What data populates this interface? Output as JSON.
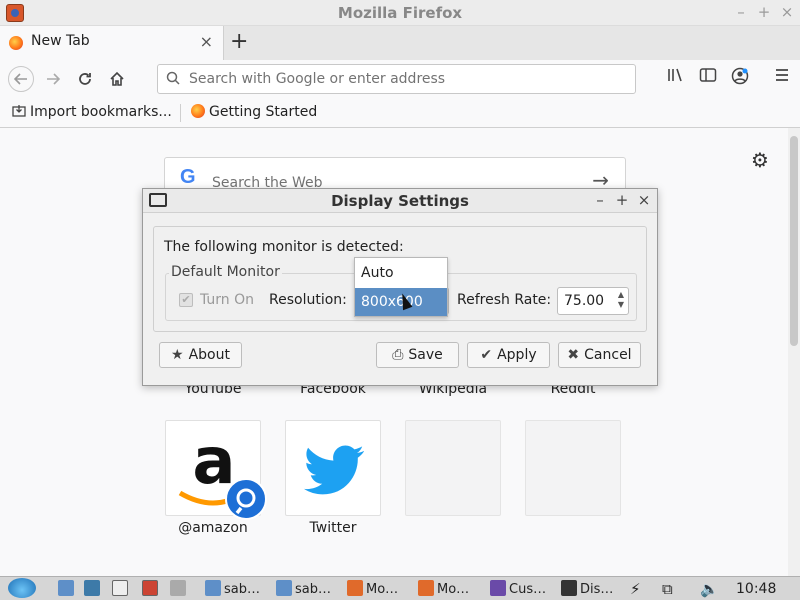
{
  "window": {
    "title": "Mozilla Firefox",
    "min": "–",
    "max": "+",
    "close": "×"
  },
  "tabs": [
    {
      "label": "New Tab",
      "close": "×"
    }
  ],
  "newtab_label": "+",
  "navbar": {
    "search_placeholder": "Search with Google or enter address"
  },
  "bookmarks": [
    {
      "label": "Import bookmarks..."
    },
    {
      "label": "Getting Started"
    }
  ],
  "newtab_page": {
    "search_placeholder": "Search the Web",
    "google_letter": "G",
    "top_sites_row1": [
      "YouTube",
      "Facebook",
      "Wikipedia",
      "Reddit"
    ],
    "top_sites_row2": [
      {
        "label": "@amazon"
      },
      {
        "label": "Twitter"
      },
      {
        "label": ""
      },
      {
        "label": ""
      }
    ]
  },
  "dialog": {
    "title": "Display Settings",
    "detected_text": "The following monitor is detected:",
    "group_label": "Default Monitor",
    "turn_on_label": "Turn On",
    "turn_on_checked": true,
    "resolution_label": "Resolution:",
    "refresh_label": "Refresh Rate:",
    "refresh_value": "75.00",
    "buttons": {
      "about": "About",
      "save": "Save",
      "apply": "Apply",
      "cancel": "Cancel"
    },
    "dropdown": {
      "options": [
        "Auto",
        "800x600"
      ],
      "selected": "800x600"
    }
  },
  "taskbar": {
    "items": [
      "sab…",
      "sab…",
      "Mo…",
      "Mo…",
      "Cus…",
      "Dis…"
    ],
    "clock": "10:48"
  },
  "colors": {
    "accent": "#5b8ec4",
    "firefox_orange": "#ff7a1a",
    "twitter_blue": "#1da1f2",
    "amazon_orange": "#ff9900"
  }
}
